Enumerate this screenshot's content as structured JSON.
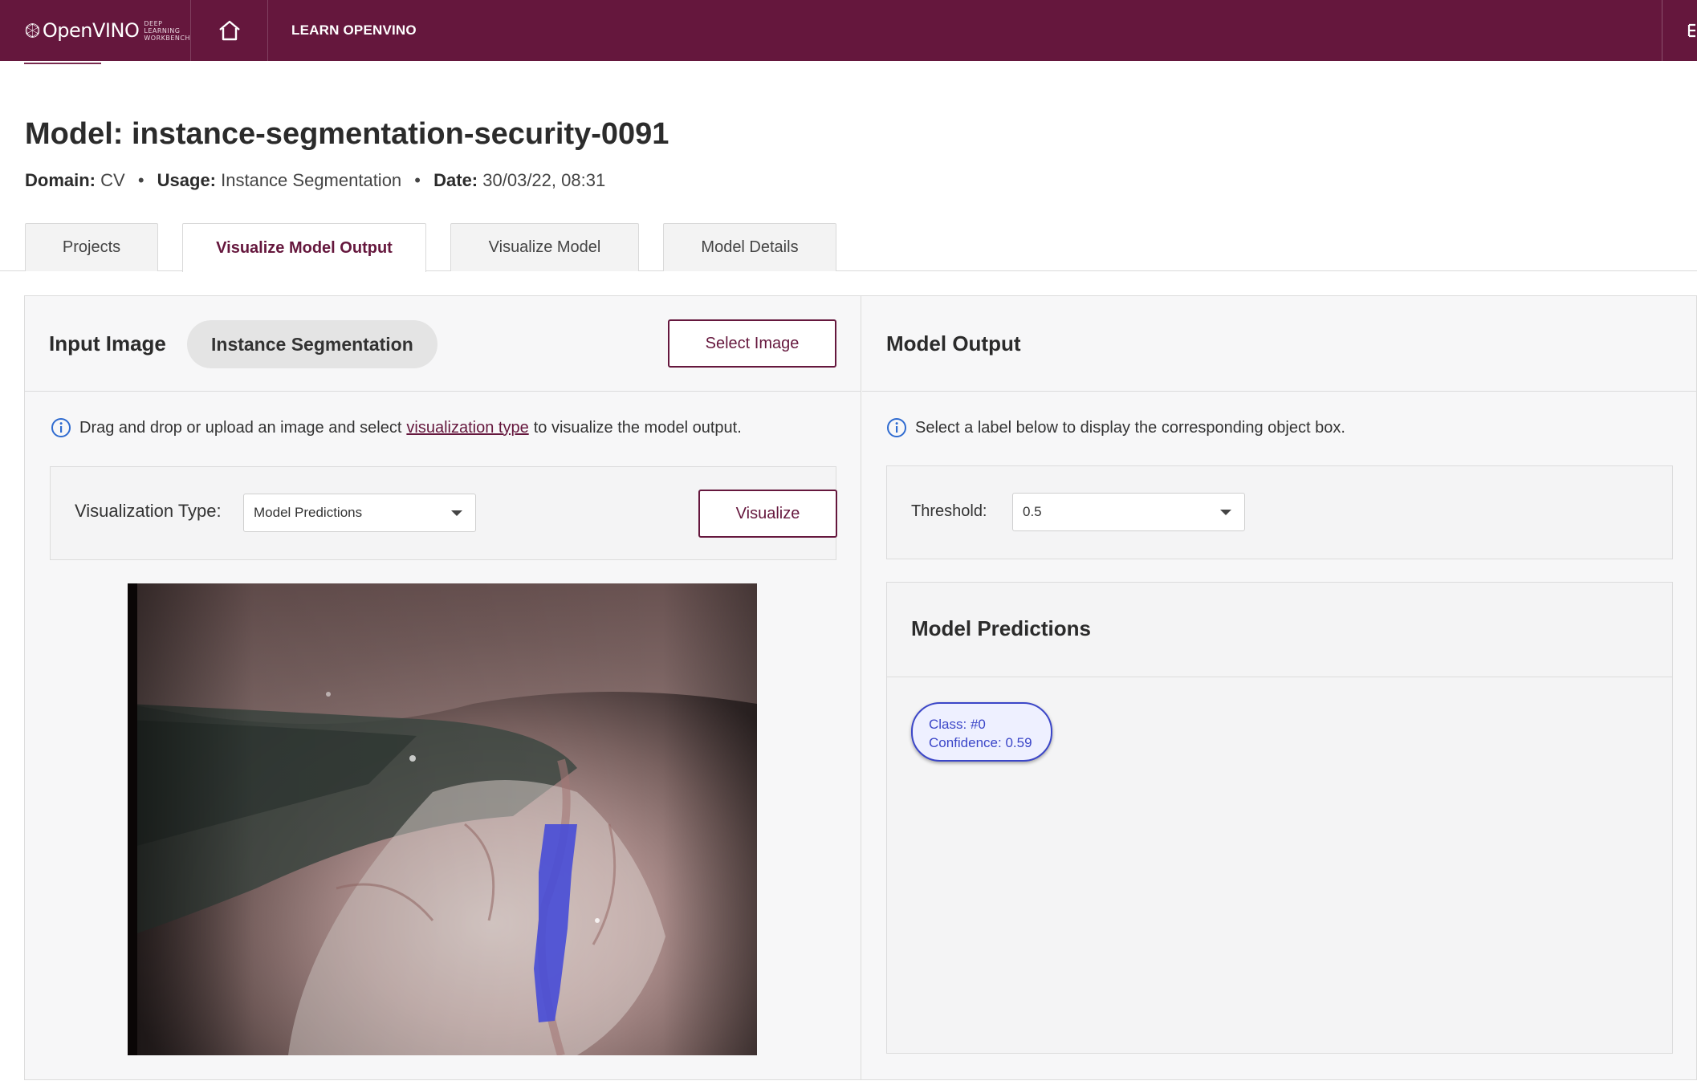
{
  "app": {
    "brand_name": "OpenVINO",
    "brand_sub_line1": "DEEP LEARNING",
    "brand_sub_line2": "WORKBENCH",
    "learn_link": "LEARN OPENVINO"
  },
  "header": {
    "title": "Model: instance-segmentation-security-0091",
    "domain_label": "Domain:",
    "domain_value": "CV",
    "usage_label": "Usage:",
    "usage_value": "Instance Segmentation",
    "date_label": "Date:",
    "date_value": "30/03/22, 08:31",
    "separator": "•"
  },
  "tabs": [
    {
      "label": "Projects",
      "active": false
    },
    {
      "label": "Visualize Model Output",
      "active": true
    },
    {
      "label": "Visualize Model",
      "active": false
    },
    {
      "label": "Model Details",
      "active": false
    }
  ],
  "input_panel": {
    "title": "Input Image",
    "task_chip": "Instance Segmentation",
    "select_image_button": "Select Image",
    "info_prefix": "Drag and drop or upload an image and select",
    "info_link": "visualization type",
    "info_suffix": "to visualize the model output.",
    "visualization_type_label": "Visualization Type:",
    "visualization_type_value": "Model Predictions",
    "visualize_button": "Visualize"
  },
  "output_panel": {
    "title": "Model Output",
    "info_text": "Select a label below to display the corresponding object box.",
    "threshold_label": "Threshold:",
    "threshold_value": "0.5",
    "predictions_title": "Model Predictions",
    "predictions": [
      {
        "class": "Class: #0",
        "confidence": "Confidence: 0.59"
      }
    ]
  },
  "colors": {
    "brand": "#65173d",
    "prediction_accent": "#3b46c8",
    "info_icon": "#2f6bd0"
  },
  "icons": {
    "logo": "openvino-logo-icon",
    "home": "home-icon",
    "info": "info-circle-icon",
    "dropdown": "caret-down-icon"
  }
}
